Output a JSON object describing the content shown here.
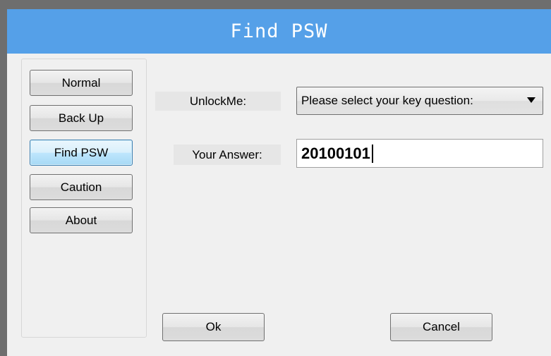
{
  "window": {
    "title": "Find PSW"
  },
  "sidebar": {
    "items": [
      {
        "label": "Normal",
        "active": false
      },
      {
        "label": "Back Up",
        "active": false
      },
      {
        "label": "Find PSW",
        "active": true
      },
      {
        "label": "Caution",
        "active": false
      },
      {
        "label": "About",
        "active": false
      }
    ]
  },
  "form": {
    "question_label": "UnlockMe:",
    "question_select_value": "Please select your key question:",
    "answer_label": "Your Answer:",
    "answer_value": "20100101"
  },
  "footer": {
    "ok_label": "Ok",
    "cancel_label": "Cancel"
  },
  "colors": {
    "titlebar": "#55a0e8",
    "active_button": "#bee6fd"
  }
}
